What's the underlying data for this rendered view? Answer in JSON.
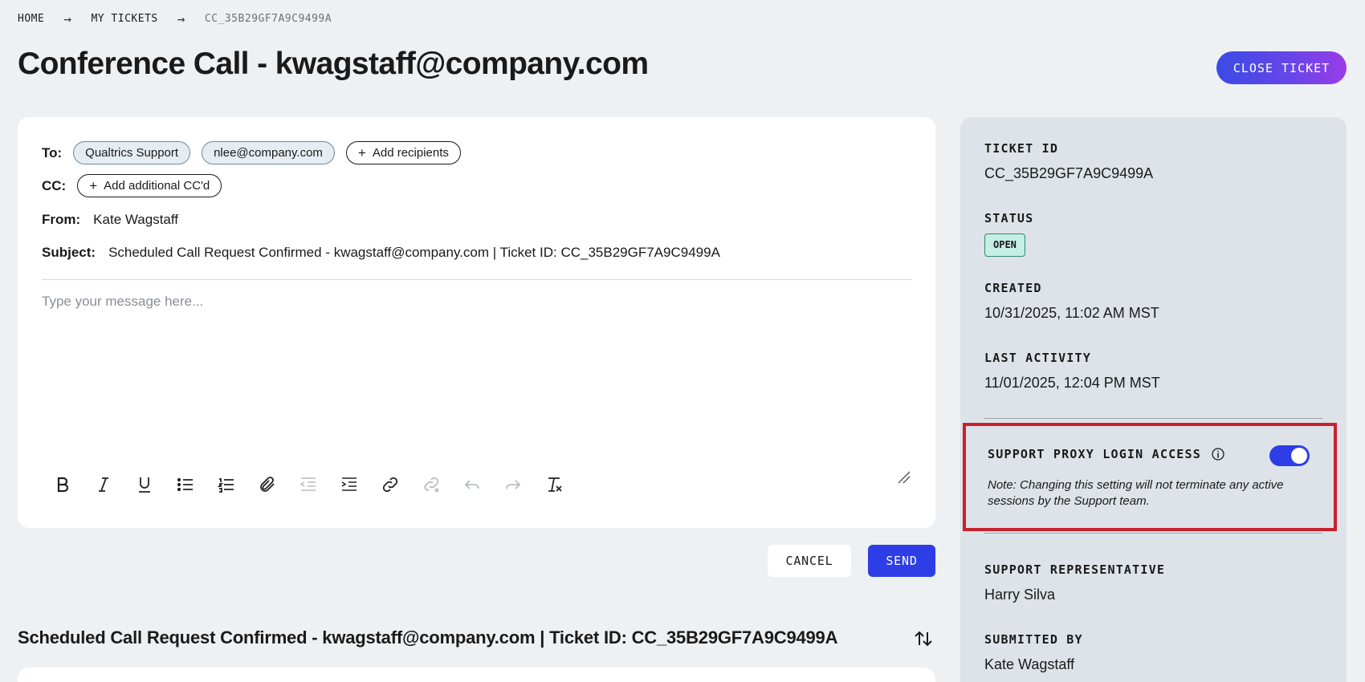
{
  "breadcrumb": {
    "home": "HOME",
    "my_tickets": "MY TICKETS",
    "current": "CC_35B29GF7A9C9499A"
  },
  "header": {
    "title": "Conference Call - kwagstaff@company.com",
    "close_ticket_label": "CLOSE TICKET"
  },
  "composer": {
    "to_label": "To:",
    "recipients": [
      "Qualtrics Support",
      "nlee@company.com"
    ],
    "add_recipients_label": "Add recipients",
    "cc_label": "CC:",
    "add_cc_label": "Add additional CC'd",
    "from_label": "From:",
    "from_value": "Kate Wagstaff",
    "subject_label": "Subject:",
    "subject_value": "Scheduled Call Request Confirmed - kwagstaff@company.com | Ticket ID: CC_35B29GF7A9C9499A",
    "message_placeholder": "Type your message here...",
    "toolbar": [
      "bold-icon",
      "italic-icon",
      "underline-icon",
      "bullet-list-icon",
      "numbered-list-icon",
      "attachment-icon",
      "outdent-icon",
      "indent-icon",
      "link-icon",
      "unlink-icon",
      "undo-icon",
      "redo-icon",
      "clear-format-icon"
    ],
    "cancel_label": "CANCEL",
    "send_label": "SEND"
  },
  "thread": {
    "title": "Scheduled Call Request Confirmed - kwagstaff@company.com | Ticket ID: CC_35B29GF7A9C9499A"
  },
  "side": {
    "ticket_id_label": "TICKET ID",
    "ticket_id": "CC_35B29GF7A9C9499A",
    "status_label": "STATUS",
    "status": "OPEN",
    "created_label": "CREATED",
    "created": "10/31/2025, 11:02 AM MST",
    "last_activity_label": "LAST ACTIVITY",
    "last_activity": "11/01/2025, 12:04 PM MST",
    "proxy_label": "SUPPORT PROXY LOGIN ACCESS",
    "proxy_enabled": true,
    "proxy_note": "Note: Changing this setting will not terminate any active sessions by the Support team.",
    "rep_label": "SUPPORT REPRESENTATIVE",
    "rep": "Harry Silva",
    "submitted_label": "SUBMITTED BY",
    "submitted": "Kate Wagstaff"
  },
  "colors": {
    "accent": "#2d3ee6",
    "status_open_bg": "#c6efe3",
    "highlight_border": "#c8202f"
  }
}
